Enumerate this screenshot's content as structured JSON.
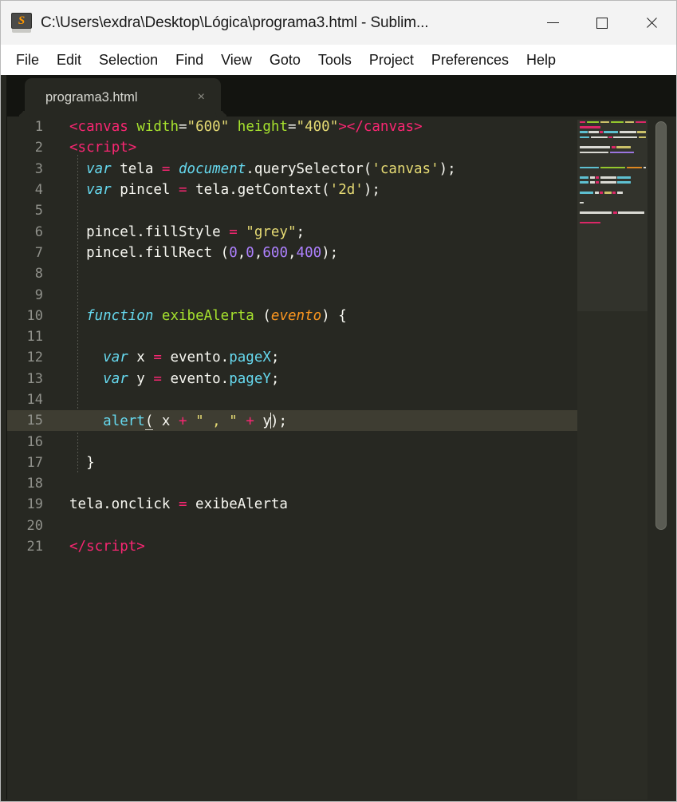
{
  "window": {
    "title": "C:\\Users\\exdra\\Desktop\\Lógica\\programa3.html - Sublim...",
    "app_icon": "sublime-text-icon",
    "controls": {
      "minimize": "—",
      "maximize": "□",
      "close": "✕"
    }
  },
  "menubar": {
    "items": [
      {
        "label": "File"
      },
      {
        "label": "Edit"
      },
      {
        "label": "Selection"
      },
      {
        "label": "Find"
      },
      {
        "label": "View"
      },
      {
        "label": "Goto"
      },
      {
        "label": "Tools"
      },
      {
        "label": "Project"
      },
      {
        "label": "Preferences"
      },
      {
        "label": "Help"
      }
    ]
  },
  "tabs": [
    {
      "label": "programa3.html",
      "close": "×",
      "active": true
    }
  ],
  "editor": {
    "active_line": 15,
    "cursor_line": 15,
    "total_lines": 21,
    "theme_colors": {
      "background": "#272822",
      "active_line": "#3e3d32",
      "foreground": "#f8f8f2",
      "line_number": "#90918b",
      "tag": "#f92672",
      "attribute": "#a6e22e",
      "string": "#e6db74",
      "number": "#ae81ff",
      "keyword": "#66d9ef",
      "function": "#a6e22e",
      "parameter": "#fd971f",
      "operator": "#f92672",
      "chrome_dark": "#131410",
      "scrollbar": "#5a5b53"
    },
    "lines": [
      {
        "n": "1",
        "tokens": [
          {
            "t": "<",
            "c": "t-tag"
          },
          {
            "t": "canvas",
            "c": "t-tag"
          },
          {
            "t": " ",
            "c": "t-plain"
          },
          {
            "t": "width",
            "c": "t-attr"
          },
          {
            "t": "=",
            "c": "t-plain"
          },
          {
            "t": "\"600\"",
            "c": "t-str"
          },
          {
            "t": " ",
            "c": "t-plain"
          },
          {
            "t": "height",
            "c": "t-attr"
          },
          {
            "t": "=",
            "c": "t-plain"
          },
          {
            "t": "\"400\"",
            "c": "t-str"
          },
          {
            "t": ">",
            "c": "t-tag"
          },
          {
            "t": "</",
            "c": "t-tag"
          },
          {
            "t": "canvas",
            "c": "t-tag"
          },
          {
            "t": ">",
            "c": "t-tag"
          }
        ]
      },
      {
        "n": "2",
        "tokens": [
          {
            "t": "<",
            "c": "t-tag"
          },
          {
            "t": "script",
            "c": "t-tag"
          },
          {
            "t": ">",
            "c": "t-tag"
          }
        ]
      },
      {
        "n": "3",
        "tokens": [
          {
            "t": "  ",
            "c": "t-plain"
          },
          {
            "t": "var",
            "c": "t-kw"
          },
          {
            "t": " tela ",
            "c": "t-plain"
          },
          {
            "t": "=",
            "c": "t-op"
          },
          {
            "t": " ",
            "c": "t-plain"
          },
          {
            "t": "document",
            "c": "t-kw"
          },
          {
            "t": ".querySelector(",
            "c": "t-plain"
          },
          {
            "t": "'canvas'",
            "c": "t-str"
          },
          {
            "t": ");",
            "c": "t-plain"
          }
        ]
      },
      {
        "n": "4",
        "tokens": [
          {
            "t": "  ",
            "c": "t-plain"
          },
          {
            "t": "var",
            "c": "t-kw"
          },
          {
            "t": " pincel ",
            "c": "t-plain"
          },
          {
            "t": "=",
            "c": "t-op"
          },
          {
            "t": " tela.getContext(",
            "c": "t-plain"
          },
          {
            "t": "'2d'",
            "c": "t-str"
          },
          {
            "t": ");",
            "c": "t-plain"
          }
        ]
      },
      {
        "n": "5",
        "tokens": []
      },
      {
        "n": "6",
        "tokens": [
          {
            "t": "  pincel.fillStyle ",
            "c": "t-plain"
          },
          {
            "t": "=",
            "c": "t-op"
          },
          {
            "t": " ",
            "c": "t-plain"
          },
          {
            "t": "\"grey\"",
            "c": "t-str"
          },
          {
            "t": ";",
            "c": "t-plain"
          }
        ]
      },
      {
        "n": "7",
        "tokens": [
          {
            "t": "  pincel.fillRect (",
            "c": "t-plain"
          },
          {
            "t": "0",
            "c": "t-num"
          },
          {
            "t": ",",
            "c": "t-plain"
          },
          {
            "t": "0",
            "c": "t-num"
          },
          {
            "t": ",",
            "c": "t-plain"
          },
          {
            "t": "600",
            "c": "t-num"
          },
          {
            "t": ",",
            "c": "t-plain"
          },
          {
            "t": "400",
            "c": "t-num"
          },
          {
            "t": ");",
            "c": "t-plain"
          }
        ]
      },
      {
        "n": "8",
        "tokens": []
      },
      {
        "n": "9",
        "tokens": []
      },
      {
        "n": "10",
        "tokens": [
          {
            "t": "  ",
            "c": "t-plain"
          },
          {
            "t": "function",
            "c": "t-kw"
          },
          {
            "t": " ",
            "c": "t-plain"
          },
          {
            "t": "exibeAlerta",
            "c": "t-fn"
          },
          {
            "t": " (",
            "c": "t-plain"
          },
          {
            "t": "evento",
            "c": "t-param"
          },
          {
            "t": ") {",
            "c": "t-plain"
          }
        ]
      },
      {
        "n": "11",
        "tokens": []
      },
      {
        "n": "12",
        "tokens": [
          {
            "t": "    ",
            "c": "t-plain"
          },
          {
            "t": "var",
            "c": "t-kw"
          },
          {
            "t": " x ",
            "c": "t-plain"
          },
          {
            "t": "=",
            "c": "t-op"
          },
          {
            "t": " evento.",
            "c": "t-plain"
          },
          {
            "t": "pageX",
            "c": "t-prop"
          },
          {
            "t": ";",
            "c": "t-plain"
          }
        ]
      },
      {
        "n": "13",
        "tokens": [
          {
            "t": "    ",
            "c": "t-plain"
          },
          {
            "t": "var",
            "c": "t-kw"
          },
          {
            "t": " y ",
            "c": "t-plain"
          },
          {
            "t": "=",
            "c": "t-op"
          },
          {
            "t": " evento.",
            "c": "t-plain"
          },
          {
            "t": "pageY",
            "c": "t-prop"
          },
          {
            "t": ";",
            "c": "t-plain"
          }
        ]
      },
      {
        "n": "14",
        "tokens": []
      },
      {
        "n": "15",
        "tokens": [
          {
            "t": "    ",
            "c": "t-plain"
          },
          {
            "t": "alert",
            "c": "t-prop"
          },
          {
            "t": "(",
            "c": "t-bracket-match"
          },
          {
            "t": " x ",
            "c": "t-plain"
          },
          {
            "t": "+",
            "c": "t-op"
          },
          {
            "t": " ",
            "c": "t-plain"
          },
          {
            "t": "\" , \"",
            "c": "t-str"
          },
          {
            "t": " ",
            "c": "t-plain"
          },
          {
            "t": "+",
            "c": "t-op"
          },
          {
            "t": " y",
            "c": "t-plain"
          },
          {
            "t": "__CARET__",
            "c": "caret-marker"
          },
          {
            "t": ")",
            "c": "t-plain"
          },
          {
            "t": ";",
            "c": "t-plain"
          }
        ]
      },
      {
        "n": "16",
        "tokens": []
      },
      {
        "n": "17",
        "tokens": [
          {
            "t": "  }",
            "c": "t-plain"
          }
        ]
      },
      {
        "n": "18",
        "tokens": []
      },
      {
        "n": "19",
        "tokens": [
          {
            "t": "tela.onclick ",
            "c": "t-plain"
          },
          {
            "t": "=",
            "c": "t-op"
          },
          {
            "t": " exibeAlerta",
            "c": "t-plain"
          }
        ]
      },
      {
        "n": "20",
        "tokens": []
      },
      {
        "n": "21",
        "tokens": [
          {
            "t": "</",
            "c": "t-tag"
          },
          {
            "t": "script",
            "c": "t-tag"
          },
          {
            "t": ">",
            "c": "t-tag"
          }
        ]
      }
    ]
  },
  "minimap": {
    "rows": [
      [
        [
          "#f92672",
          11
        ],
        [
          "#a6e22e",
          22
        ],
        [
          "#e6db74",
          17
        ],
        [
          "#a6e22e",
          24
        ],
        [
          "#e6db74",
          17
        ],
        [
          "#f92672",
          20
        ]
      ],
      [
        [
          "#f92672",
          26
        ]
      ],
      [
        [
          "#66d9ef",
          14
        ],
        [
          "#f8f8f2",
          18
        ],
        [
          "#f92672",
          5
        ],
        [
          "#66d9ef",
          26
        ],
        [
          "#f8f8f2",
          30
        ],
        [
          "#e6db74",
          16
        ]
      ],
      [
        [
          "#66d9ef",
          14
        ],
        [
          "#f8f8f2",
          24
        ],
        [
          "#f92672",
          5
        ],
        [
          "#f8f8f2",
          34
        ],
        [
          "#e6db74",
          11
        ]
      ],
      [],
      [
        [
          "#f8f8f2",
          38
        ],
        [
          "#f92672",
          5
        ],
        [
          "#e6db74",
          18
        ]
      ],
      [
        [
          "#f8f8f2",
          36
        ],
        [
          "#ae81ff",
          30
        ]
      ],
      [],
      [],
      [
        [
          "#66d9ef",
          26
        ],
        [
          "#a6e22e",
          34
        ],
        [
          "#fd971f",
          21
        ],
        [
          "#f8f8f2",
          4
        ]
      ],
      [],
      [
        [
          "#66d9ef",
          11
        ],
        [
          "#f8f8f2",
          6
        ],
        [
          "#f92672",
          4
        ],
        [
          "#f8f8f2",
          20
        ],
        [
          "#66d9ef",
          17
        ]
      ],
      [
        [
          "#66d9ef",
          11
        ],
        [
          "#f8f8f2",
          6
        ],
        [
          "#f92672",
          4
        ],
        [
          "#f8f8f2",
          20
        ],
        [
          "#66d9ef",
          17
        ]
      ],
      [],
      [
        [
          "#66d9ef",
          17
        ],
        [
          "#f8f8f2",
          5
        ],
        [
          "#f92672",
          4
        ],
        [
          "#e6db74",
          9
        ],
        [
          "#f92672",
          4
        ],
        [
          "#f8f8f2",
          7
        ]
      ],
      [],
      [
        [
          "#f8f8f2",
          5
        ]
      ],
      [],
      [
        [
          "#f8f8f2",
          40
        ],
        [
          "#f92672",
          5
        ],
        [
          "#f8f8f2",
          33
        ]
      ],
      [],
      [
        [
          "#f92672",
          26
        ]
      ]
    ]
  },
  "scrollbar": {
    "name": "vertical-scrollbar"
  }
}
